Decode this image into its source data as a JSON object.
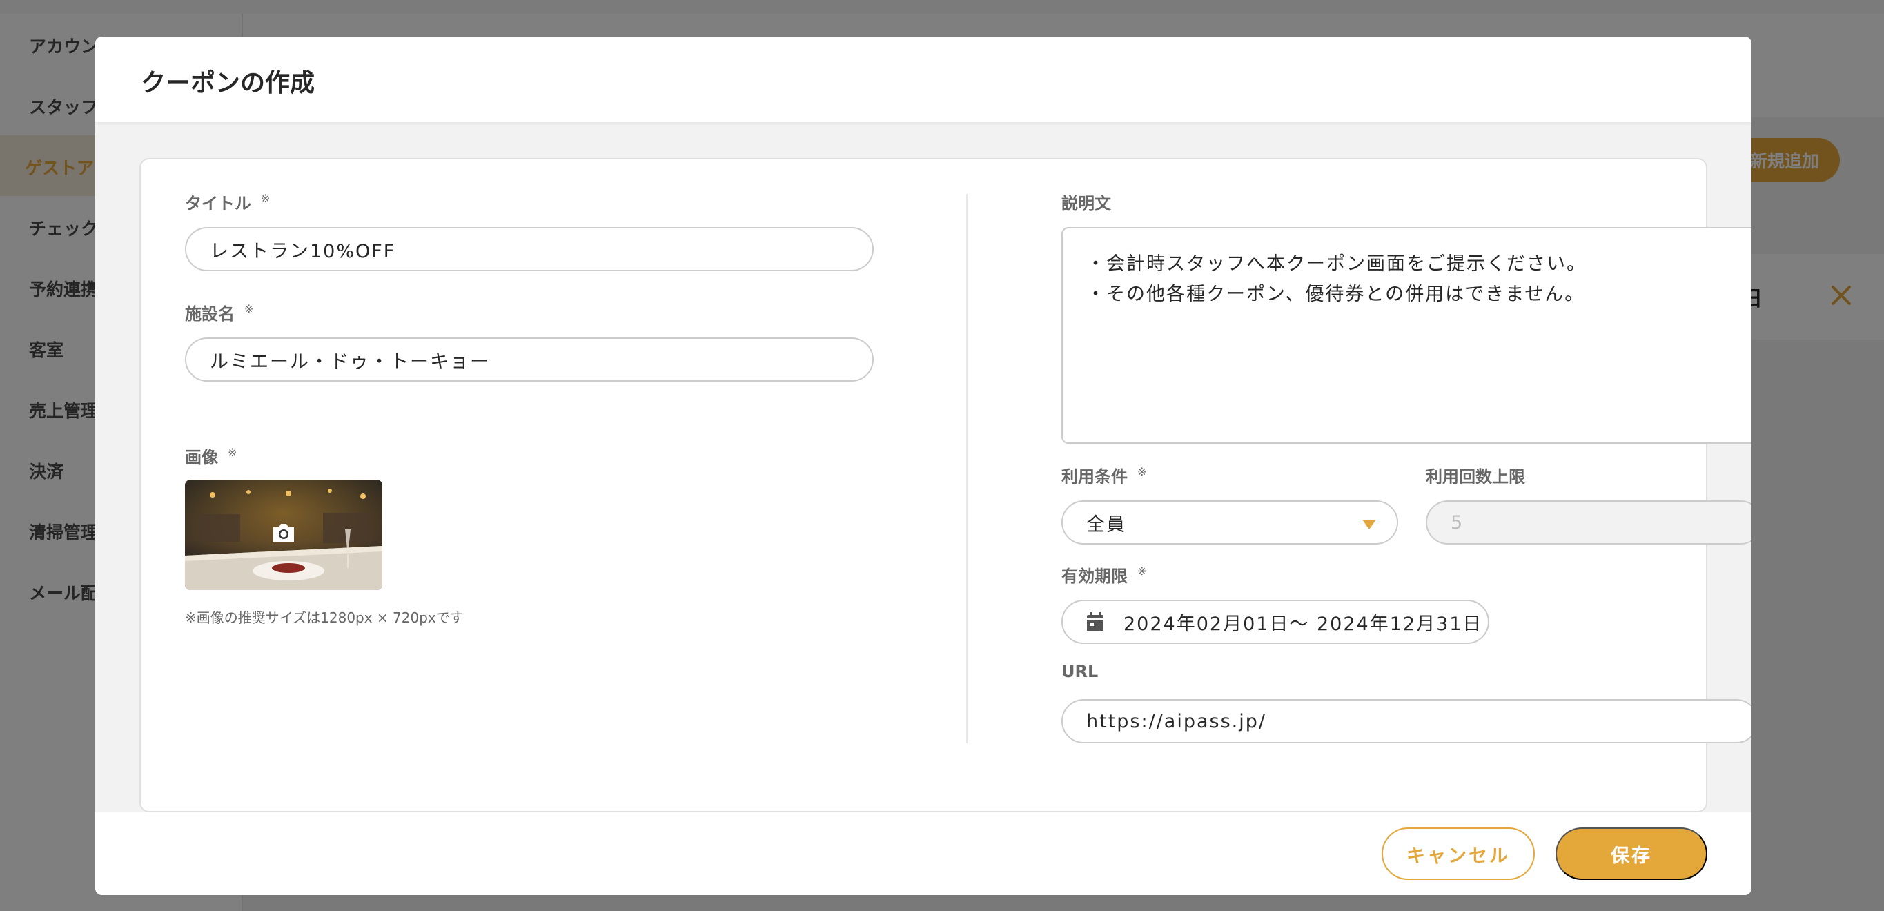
{
  "background": {
    "sidebar": {
      "items": [
        {
          "label": "アカウン"
        },
        {
          "label": "スタッフ"
        },
        {
          "label": "ゲストア"
        },
        {
          "label": "チェック"
        },
        {
          "label": "予約連携"
        },
        {
          "label": "客室"
        },
        {
          "label": "売上管理"
        },
        {
          "label": "決済"
        },
        {
          "label": "清掃管理"
        },
        {
          "label": "メール配"
        }
      ],
      "active_index": 2
    },
    "add_button_label": "新規追加",
    "panel_text": "日"
  },
  "modal": {
    "title": "クーポンの作成",
    "required_mark": "※",
    "fields": {
      "title": {
        "label": "タイトル",
        "value": "レストラン10%OFF"
      },
      "facility": {
        "label": "施設名",
        "value": "ルミエール・ドゥ・トーキョー"
      },
      "image": {
        "label": "画像",
        "note": "※画像の推奨サイズは1280px × 720pxです"
      },
      "description": {
        "label": "説明文",
        "lines": [
          "・会計時スタッフへ本クーポン画面をご提示ください。",
          "・その他各種クーポン、優待券との併用はできません。"
        ]
      },
      "condition": {
        "label": "利用条件",
        "value": "全員"
      },
      "usage_limit": {
        "label": "利用回数上限",
        "value": "5"
      },
      "validity": {
        "label": "有効期限",
        "value": "2024年02月01日～ 2024年12月31日"
      },
      "url": {
        "label": "URL",
        "value": "https://aipass.jp/"
      }
    },
    "footer": {
      "cancel_label": "キャンセル",
      "save_label": "保存"
    }
  },
  "colors": {
    "accent": "#e4a73a",
    "text": "#272727",
    "label": "#676767"
  }
}
